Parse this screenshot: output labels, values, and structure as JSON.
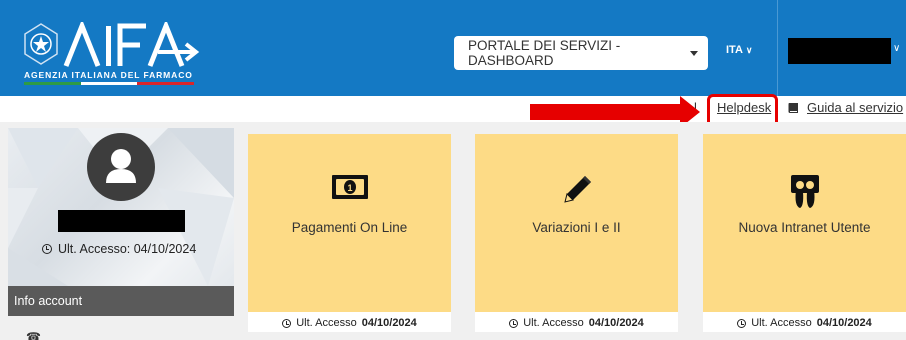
{
  "header": {
    "logo_text": "AIFA",
    "logo_subtitle": "AGENZIA ITALIANA DEL FARMACO",
    "portal_select": "PORTALE DEI SERVIZI - DASHBOARD",
    "language": "ITA",
    "colors": {
      "bar": "#1479c4"
    }
  },
  "subbar": {
    "fragment_text": "l",
    "helpdesk_label": "Helpdesk",
    "guide_label": "Guida al servizio",
    "highlight_color": "#e60000"
  },
  "profile": {
    "last_access": "Ult. Accesso: 04/10/2024",
    "info_label": "Info account"
  },
  "cards": [
    {
      "title": "Pagamenti On Line",
      "access_label": "Ult. Accesso",
      "access_date": "04/10/2024",
      "icon": "money-icon"
    },
    {
      "title": "Variazioni I e II",
      "access_label": "Ult. Accesso",
      "access_date": "04/10/2024",
      "icon": "pencil-icon"
    },
    {
      "title": "Nuova Intranet Utente",
      "access_label": "Ult. Accesso",
      "access_date": "04/10/2024",
      "icon": "slideshare-icon"
    }
  ],
  "colors": {
    "card": "#fddb86",
    "panel_gray": "#5a5a5a"
  }
}
